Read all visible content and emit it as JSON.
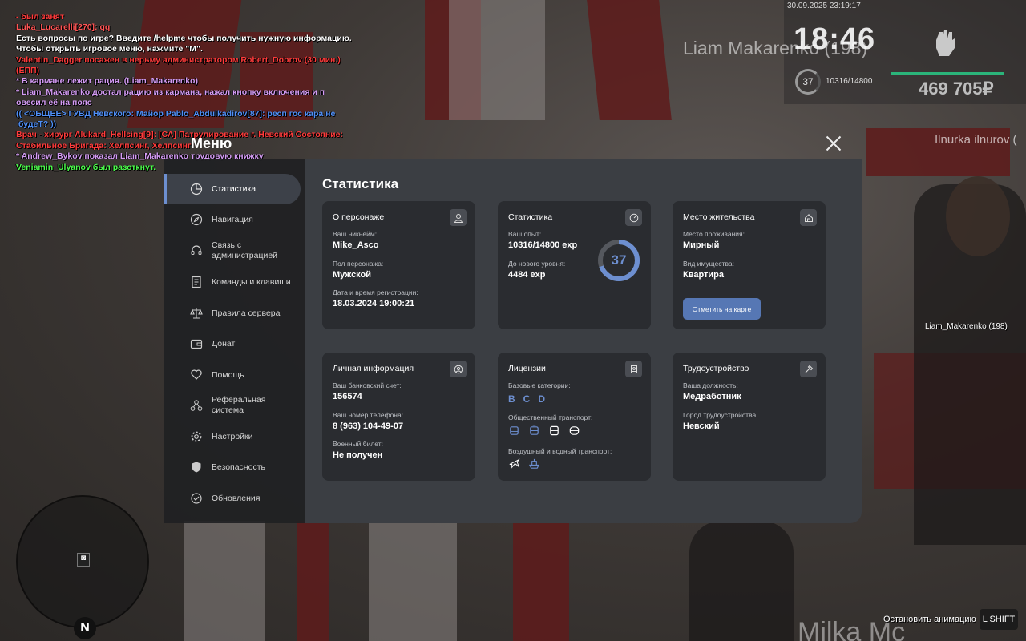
{
  "chat": [
    {
      "text": "- был занят",
      "color": "#ff3b3b"
    },
    {
      "text": "Luka_Lucarelli[270]: qq",
      "color": "#ff5555"
    },
    {
      "text": "Есть вопросы по игре? Введите /helpme чтобы получить нужную информацию.",
      "color": "#ffffff"
    },
    {
      "text": "Чтобы открыть игровое меню, нажмите \"M\".",
      "color": "#ffffff"
    },
    {
      "text": "Valentin_Dagger посажен в нерьму администратором Robert_Dobrov (30 мин.)",
      "color": "#ff3b3b"
    },
    {
      "text": "(ЕПП)",
      "color": "#ff3b3b"
    },
    {
      "text": "* В кармане лежит рация. (Liam_Makarenko)",
      "color": "#d59cf5"
    },
    {
      "text": "* Liam_Makarenko достал рацию из кармана, нажал кнопку включения и п",
      "color": "#d59cf5"
    },
    {
      "text": "овесил её на пояс",
      "color": "#d59cf5"
    },
    {
      "text": "(( <ОБЩЕЕ> ГУВД Невского: Майор Pablo_Abdulkadirov[87]: респ гос кара не",
      "color": "#4f8ff7"
    },
    {
      "text": " будеТ? ))",
      "color": "#4f8ff7"
    },
    {
      "text": "Врач - хирург Alukard_Hellsing[9]: [СА] Патрулирование г. Невский Состояние:",
      "color": "#ff3b3b"
    },
    {
      "text": "Стабильное Бригада: Хелпсинг, Хелпсинг",
      "color": "#ff3b3b"
    },
    {
      "text": "* Andrew_Bykov показал Liam_Makarenko трудовую книжку",
      "color": "#d59cf5"
    },
    {
      "text": "Veniamin_Ulyanov был разоткнут.",
      "color": "#4cff4c"
    }
  ],
  "hud": {
    "datetime": "30.09.2025 23:19:17",
    "time": "18:46",
    "level": "37",
    "exp": "10316/14800",
    "money": "469 705₽",
    "health_color": "#2bb47a"
  },
  "world": {
    "nametag_top": "Liam Makarenko (198)",
    "nametag_right": "Ilnurka ilnurov (",
    "nametag_bottom": "Milka Mc",
    "player_label": "Liam_Makarenko (198)"
  },
  "minimap": {
    "north": "N",
    "blip": "◙"
  },
  "hint": {
    "text": "Остановить анимацию",
    "key": "L SHIFT"
  },
  "menu": {
    "title": "Меню",
    "accent": "#6d8fd0",
    "sidebar": [
      {
        "label": "Статистика",
        "icon": "pie-chart-icon",
        "active": true
      },
      {
        "label": "Навигация",
        "icon": "compass-icon"
      },
      {
        "label": "Связь с администрацией",
        "icon": "headset-icon"
      },
      {
        "label": "Команды и клавиши",
        "icon": "document-icon"
      },
      {
        "label": "Правила сервера",
        "icon": "scales-icon"
      },
      {
        "label": "Донат",
        "icon": "wallet-icon"
      },
      {
        "label": "Помощь",
        "icon": "heart-hand-icon"
      },
      {
        "label": "Реферальная система",
        "icon": "network-icon"
      },
      {
        "label": "Настройки",
        "icon": "gear-icon"
      },
      {
        "label": "Безопасность",
        "icon": "shield-icon"
      },
      {
        "label": "Обновления",
        "icon": "refresh-icon"
      }
    ],
    "panel_title": "Статистика",
    "cards": {
      "character": {
        "title": "О персонаже",
        "nick_label": "Ваш никнейм:",
        "nick": "Mike_Asco",
        "gender_label": "Пол персонажа:",
        "gender": "Мужской",
        "reg_label": "Дата и время регистрации:",
        "reg": "18.03.2024 19:00:21"
      },
      "stats": {
        "title": "Статистика",
        "exp_label": "Ваш опыт:",
        "exp": "10316/14800 exp",
        "next_label": "До нового уровня:",
        "next": "4484 exp",
        "level": "37",
        "progress": 0.697
      },
      "residence": {
        "title": "Место жительства",
        "place_label": "Место проживания:",
        "place": "Мирный",
        "type_label": "Вид имущества:",
        "type": "Квартира",
        "button": "Отметить на карте"
      },
      "personal": {
        "title": "Личная информация",
        "bank_label": "Ваш банковский счет:",
        "bank": "156574",
        "phone_label": "Ваш номер телефона:",
        "phone": "8 (963) 104-49-07",
        "military_label": "Военный билет:",
        "military": "Не получен"
      },
      "licenses": {
        "title": "Лицензии",
        "base_label": "Базовые категории:",
        "base": [
          "B",
          "C",
          "D"
        ],
        "public_label": "Общественный транспорт:",
        "air_label": "Воздушный и водный транспорт:"
      },
      "job": {
        "title": "Трудоустройство",
        "position_label": "Ваша должность:",
        "position": "Медработник",
        "city_label": "Город трудоустройства:",
        "city": "Невский"
      }
    }
  }
}
